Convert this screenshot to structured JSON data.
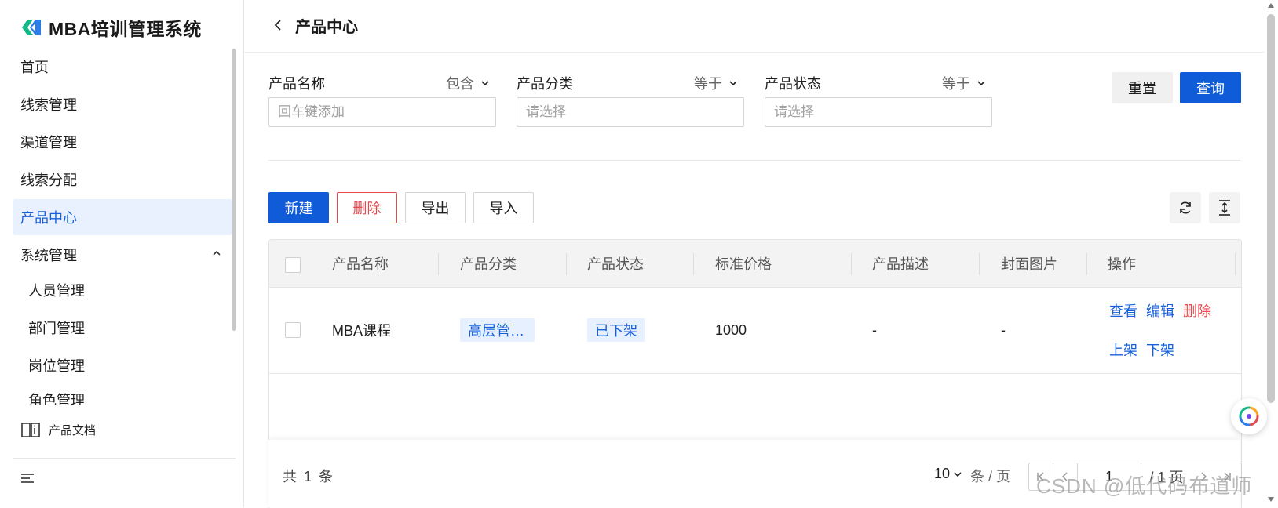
{
  "app": {
    "title": "MBA培训管理系统"
  },
  "colors": {
    "primary": "#0f5bd8",
    "danger": "#e5484d",
    "tag_bg": "#e7f0ff",
    "active_nav_bg": "#e9f1ff"
  },
  "sidebar": {
    "items": [
      {
        "label": "首页"
      },
      {
        "label": "线索管理"
      },
      {
        "label": "渠道管理"
      },
      {
        "label": "线索分配"
      },
      {
        "label": "产品中心",
        "active": true
      },
      {
        "label": "系统管理",
        "expanded": true
      }
    ],
    "sub_items": [
      {
        "label": "人员管理"
      },
      {
        "label": "部门管理"
      },
      {
        "label": "岗位管理"
      },
      {
        "label": "角色管理"
      }
    ],
    "doc_link": "产品文档",
    "icons": {
      "back": "chevron-left-icon",
      "collapse": "chevron-up-icon",
      "docs": "book-icon",
      "menu": "menu-icon"
    }
  },
  "header": {
    "title": "产品中心"
  },
  "filters": [
    {
      "label": "产品名称",
      "operator": "包含",
      "placeholder": "回车键添加"
    },
    {
      "label": "产品分类",
      "operator": "等于",
      "placeholder": "请选择"
    },
    {
      "label": "产品状态",
      "operator": "等于",
      "placeholder": "请选择"
    }
  ],
  "filter_actions": {
    "reset": "重置",
    "query": "查询"
  },
  "toolbar": {
    "new": "新建",
    "delete": "删除",
    "export": "导出",
    "import": "导入",
    "icons": [
      "refresh-icon",
      "expand-vertical-icon"
    ]
  },
  "table": {
    "columns": [
      "产品名称",
      "产品分类",
      "产品状态",
      "标准价格",
      "产品描述",
      "封面图片",
      "操作"
    ],
    "rows": [
      {
        "name": "MBA课程",
        "category": "高层管…",
        "status": "已下架",
        "price": "1000",
        "description": "-",
        "cover": "-",
        "actions": {
          "view": "查看",
          "edit": "编辑",
          "delete": "删除",
          "on_shelf": "上架",
          "off_shelf": "下架"
        }
      }
    ]
  },
  "footer": {
    "total_prefix": "共",
    "total": "1",
    "total_suffix": "条",
    "page_size": "10",
    "page_size_unit": "条 / 页",
    "current_page": "1",
    "page_total": "/ 1 页"
  },
  "watermark": "CSDN @低代码布道师"
}
